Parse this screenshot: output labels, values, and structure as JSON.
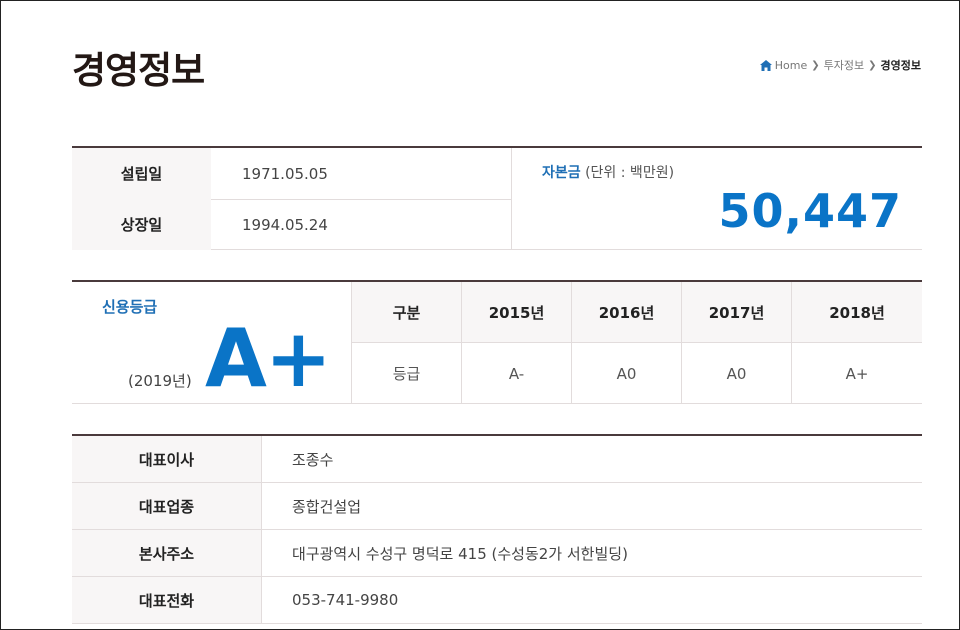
{
  "header": {
    "title": "경영정보",
    "breadcrumb": {
      "home": "Home",
      "parent": "투자정보",
      "current": "경영정보"
    }
  },
  "summary": {
    "rows": [
      {
        "label": "설립일",
        "value": "1971.05.05"
      },
      {
        "label": "상장일",
        "value": "1994.05.24"
      }
    ],
    "capital": {
      "label": "자본금",
      "unit": "(단위 : 백만원)",
      "value": "50,447"
    }
  },
  "credit": {
    "title": "신용등급",
    "year": "(2019년)",
    "grade": "A+",
    "table": {
      "header_label": "구분",
      "years": [
        "2015년",
        "2016년",
        "2017년",
        "2018년"
      ],
      "row_label": "등급",
      "grades": [
        "A-",
        "A0",
        "A0",
        "A+"
      ]
    }
  },
  "company": {
    "rows": [
      {
        "label": "대표이사",
        "value": "조종수"
      },
      {
        "label": "대표업종",
        "value": "종합건설업"
      },
      {
        "label": "본사주소",
        "value": "대구광역시 수성구 명덕로 415 (수성동2가 서한빌딩)"
      },
      {
        "label": "대표전화",
        "value": "053-741-9980"
      }
    ]
  },
  "colors": {
    "accent_blue": "#0a74c7",
    "label_blue": "#1f6fb5",
    "rule": "#4a3a3c"
  }
}
